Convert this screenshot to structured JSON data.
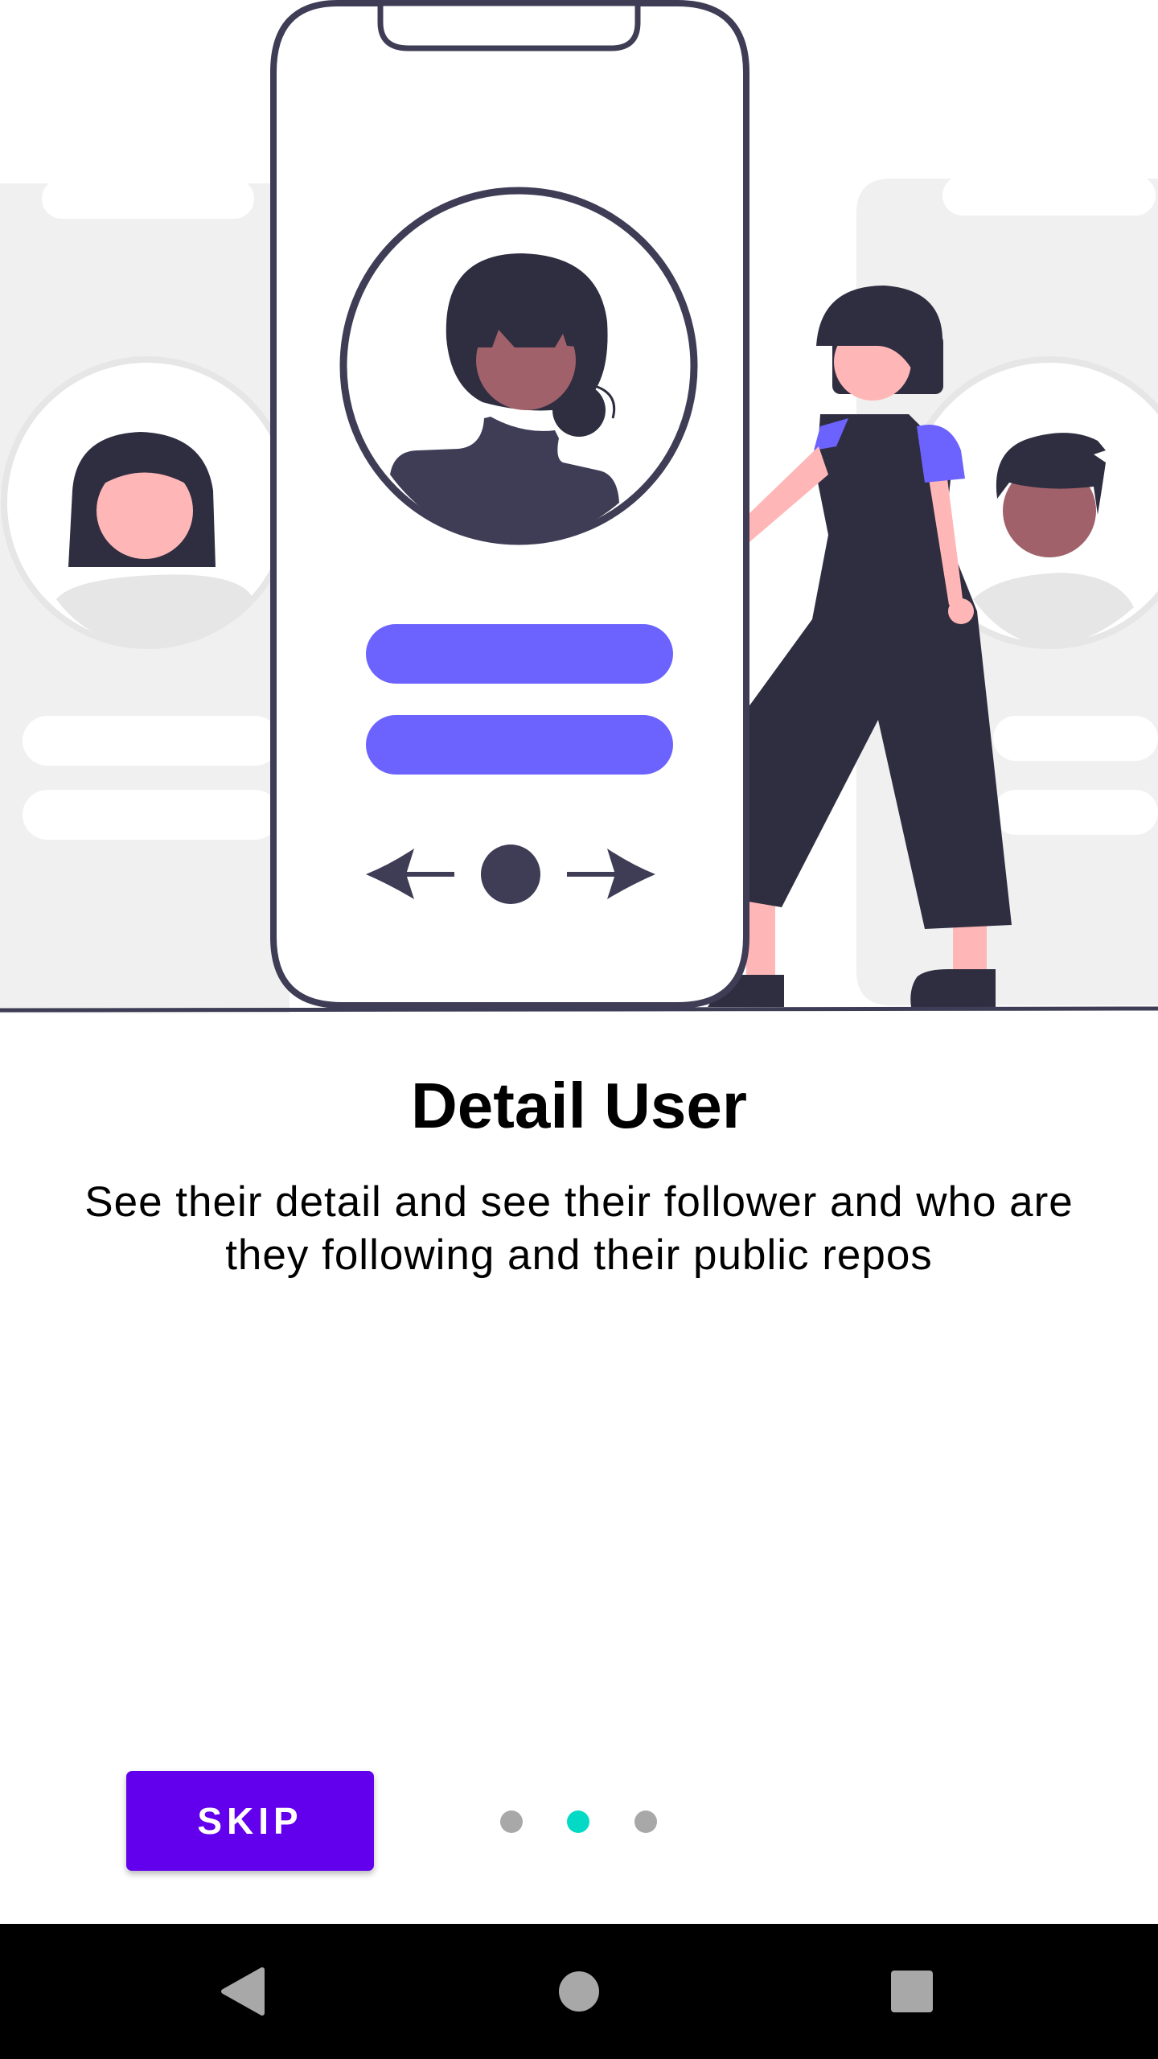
{
  "onboarding": {
    "title": "Detail User",
    "description": "See their detail and see their follower and who are they following and their public repos"
  },
  "actions": {
    "skip_label": "SKIP"
  },
  "pager": {
    "page_count": 3,
    "active_index": 1
  },
  "colors": {
    "primary": "#6200ee",
    "indicator_active": "#03dac5",
    "indicator_inactive": "#a8a8a8",
    "illustration_accent": "#6c63ff",
    "illustration_dark": "#2f2e41"
  },
  "icons": {
    "back": "back-triangle-icon",
    "home": "home-circle-icon",
    "recents": "recents-square-icon"
  }
}
